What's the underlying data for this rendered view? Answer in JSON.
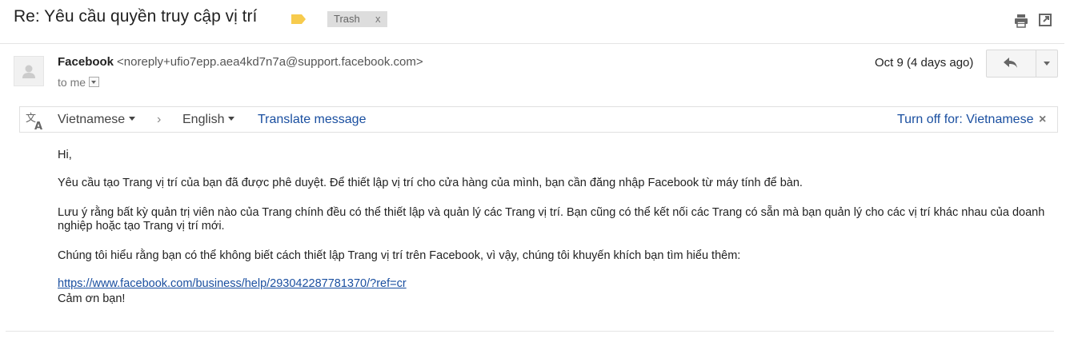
{
  "header": {
    "subject": "Re: Yêu cầu quyền truy cập vị trí",
    "trash_label": "Trash",
    "trash_remove": "x",
    "label_color": "#f7cb4d"
  },
  "sender": {
    "name": "Facebook",
    "email": "<noreply+ufio7epp.aea4kd7n7a@support.facebook.com>",
    "to": "to me",
    "date": "Oct 9 (4 days ago)"
  },
  "translate": {
    "source_lang": "Vietnamese",
    "separator": "›",
    "target_lang": "English",
    "translate_link": "Translate message",
    "turn_off": "Turn off for: Vietnamese",
    "close": "×"
  },
  "body": {
    "greeting": "Hi,",
    "paragraph1": "Yêu cầu tạo Trang vị trí của bạn đã được phê duyệt. Để thiết lập vị trí cho cửa hàng của mình, bạn cần đăng nhập Facebook từ máy tính để bàn.",
    "paragraph2": "Lưu ý rằng bất kỳ quản trị viên nào của Trang chính đều có thể thiết lập và quản lý các Trang vị trí. Bạn cũng có thể kết nối các Trang có sẵn mà bạn quản lý cho các vị trí khác nhau của doanh nghiệp hoặc tạo Trang vị trí mới.",
    "paragraph3": "Chúng tôi hiểu rằng bạn có thể không biết cách thiết lập Trang vị trí trên Facebook, vì vậy, chúng tôi khuyến khích bạn tìm hiểu thêm:",
    "link": "https://www.facebook.com/business/help/293042287781370/?ref=cr",
    "closing": "Cảm ơn bạn!"
  },
  "colors": {
    "link": "#1a4fa0",
    "chip_bg": "#dddddd"
  }
}
